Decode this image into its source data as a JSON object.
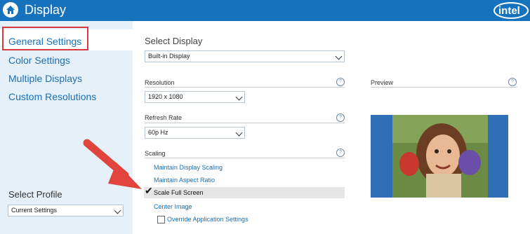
{
  "window": {
    "title": "Display"
  },
  "sidebar": {
    "items": [
      {
        "label": "General Settings"
      },
      {
        "label": "Color Settings"
      },
      {
        "label": "Multiple Displays"
      },
      {
        "label": "Custom Resolutions"
      }
    ],
    "profile": {
      "label": "Select Profile",
      "value": "Current Settings"
    }
  },
  "main": {
    "select_display": {
      "title": "Select Display",
      "value": "Built-in Display"
    },
    "resolution": {
      "label": "Resolution",
      "value": "1920 x 1080"
    },
    "refresh_rate": {
      "label": "Refresh Rate",
      "value": "60p Hz"
    },
    "scaling": {
      "label": "Scaling",
      "options": [
        {
          "label": "Maintain Display Scaling"
        },
        {
          "label": "Maintain Aspect Ratio"
        },
        {
          "label": "Scale Full Screen",
          "checked": true
        },
        {
          "label": "Center Image"
        }
      ],
      "override_label": "Override Application Settings"
    },
    "preview": {
      "label": "Preview"
    }
  },
  "colors": {
    "titlebar": "#1672bd",
    "accent": "#1a6fb5",
    "highlight": "#d9383c"
  },
  "icons": {
    "home": "home-icon",
    "help": "help-icon",
    "arrow": "red-arrow-icon",
    "logo": "intel-logo"
  }
}
